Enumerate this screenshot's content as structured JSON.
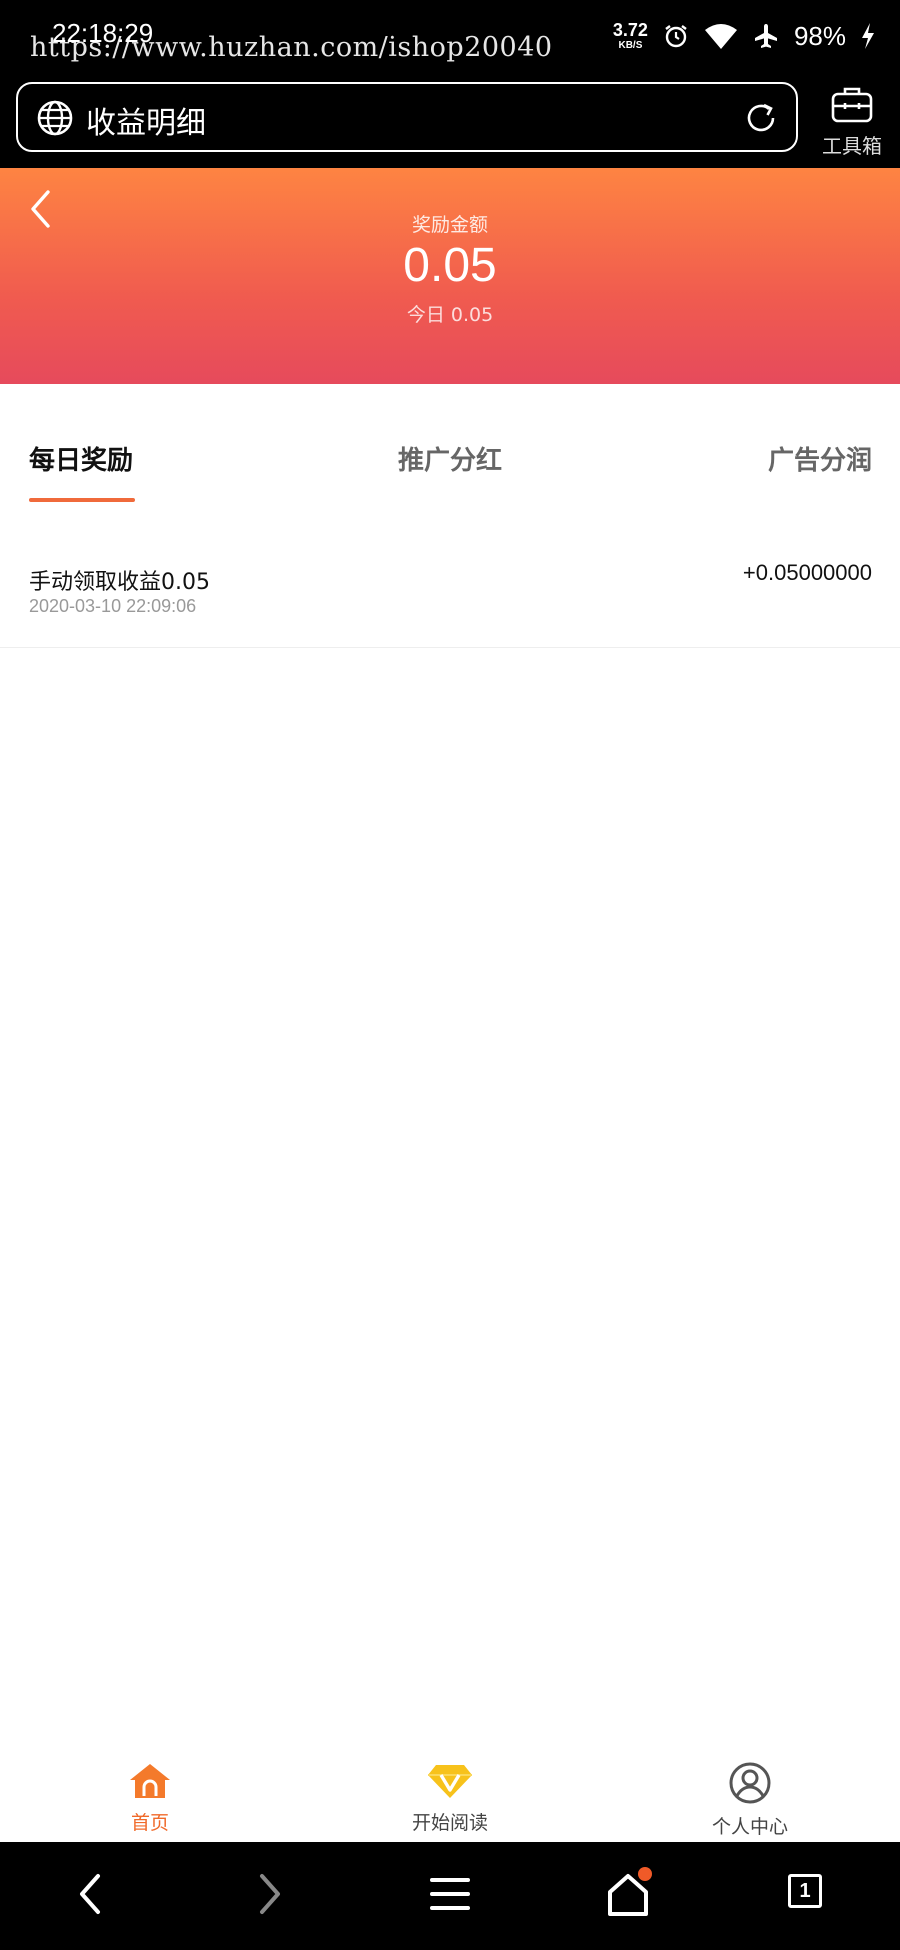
{
  "status_bar": {
    "time": "22:18:29",
    "watermark": "https://www.huzhan.com/ishop20040",
    "net_speed": "3.72",
    "net_speed_unit": "KB/S",
    "battery": "98%"
  },
  "browser": {
    "page_title": "收益明细",
    "toolbox_label": "工具箱"
  },
  "header": {
    "label": "奖励金额",
    "amount": "0.05",
    "today": "今日 0.05"
  },
  "tabs": [
    {
      "label": "每日奖励",
      "active": true
    },
    {
      "label": "推广分红",
      "active": false
    },
    {
      "label": "广告分润",
      "active": false
    }
  ],
  "records": [
    {
      "title": "手动领取收益0.05",
      "time": "2020-03-10 22:09:06",
      "amount": "+0.05000000"
    }
  ],
  "app_nav": [
    {
      "label": "首页",
      "icon": "home-icon",
      "active": true
    },
    {
      "label": "开始阅读",
      "icon": "diamond-v-icon",
      "active": false
    },
    {
      "label": "个人中心",
      "icon": "user-circle-icon",
      "active": false
    }
  ],
  "system_bar": {
    "tab_count": "1"
  },
  "colors": {
    "accent": "#f06a3b",
    "header_top": "#fe8442",
    "header_bottom": "#e64a5c",
    "nav_active": "#f06a2a"
  }
}
